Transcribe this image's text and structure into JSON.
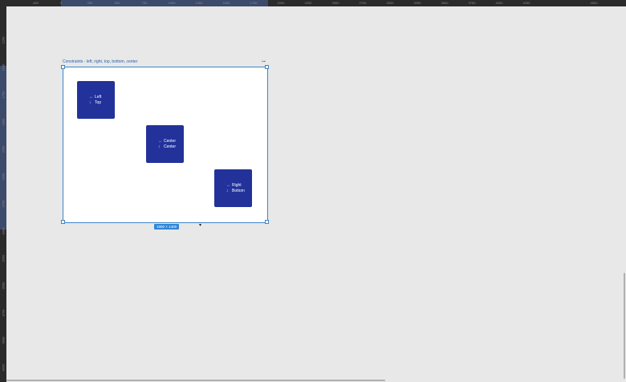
{
  "rulers": {
    "top_ticks": [
      "-450",
      "0",
      "250",
      "500",
      "750",
      "1000",
      "1250",
      "1500",
      "1750",
      "2000",
      "2250",
      "2500",
      "2750",
      "3000",
      "3250",
      "3500",
      "3750",
      "4000",
      "4250",
      "4500"
    ],
    "left_ticks": [
      "1250",
      "1500",
      "1750",
      "2000",
      "2250",
      "2500",
      "2750",
      "3000",
      "3250",
      "3500",
      "3750",
      "4000",
      "4250"
    ]
  },
  "frame": {
    "title": "Constraints - left, right, top, bottom, center",
    "icon": "frame-settings-icon",
    "size_label": "1900 × 1400"
  },
  "boxes": [
    {
      "h_label": "Left",
      "v_label": "Top"
    },
    {
      "h_label": "Center",
      "v_label": "Center"
    },
    {
      "h_label": "Right",
      "v_label": "Bottom"
    }
  ],
  "colors": {
    "canvas": "#e8e8e8",
    "frame_border": "#3d86c6",
    "box": "#22329a",
    "badge": "#2f86d6"
  }
}
